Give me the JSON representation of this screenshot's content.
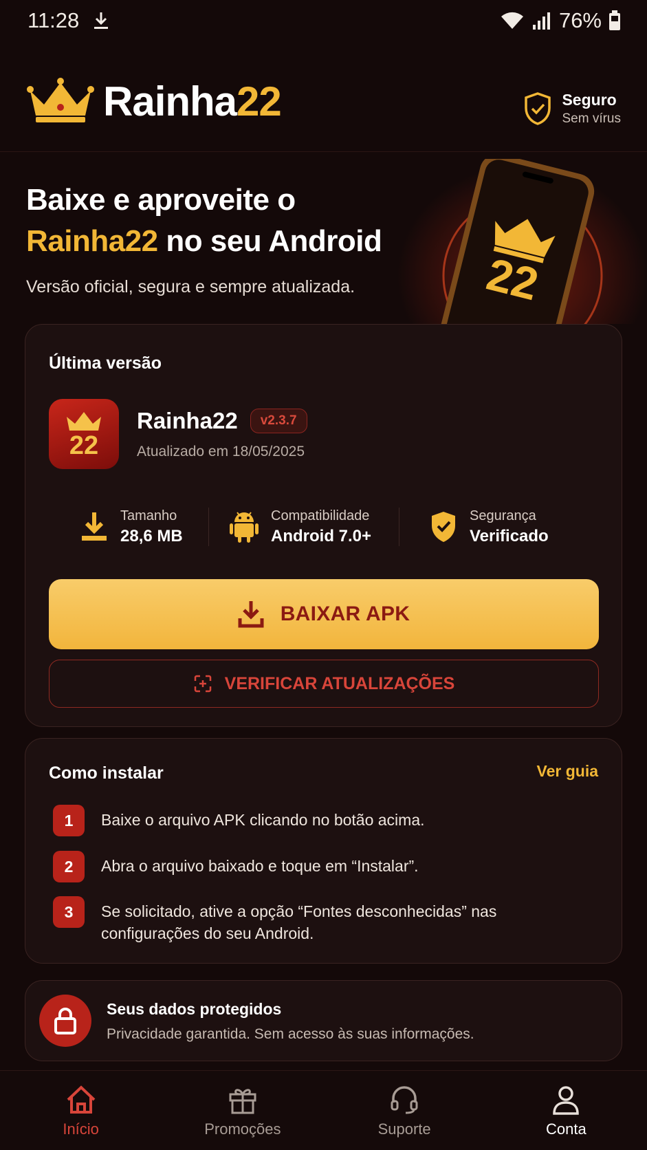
{
  "status_bar": {
    "time": "11:28",
    "battery": "76%"
  },
  "header": {
    "brand_main": "Rainha",
    "brand_accent": "22",
    "secure_title": "Seguro",
    "secure_subtitle": "Sem vírus"
  },
  "hero": {
    "title_line1": "Baixe e aproveite o",
    "title_accent": "Rainha22",
    "title_line2_rest": " no seu Android",
    "subtitle": "Versão oficial, segura e sempre atualizada.",
    "phone_number": "22"
  },
  "latest": {
    "section_title": "Última versão",
    "app_icon_number": "22",
    "app_name": "Rainha22",
    "version": "v2.3.7",
    "updated": "Atualizado em 18/05/2025",
    "specs": [
      {
        "label": "Tamanho",
        "value": "28,6 MB",
        "icon": "download-icon"
      },
      {
        "label": "Compatibilidade",
        "value": "Android 7.0+",
        "icon": "android-icon"
      },
      {
        "label": "Segurança",
        "value": "Verificado",
        "icon": "shield-check-icon"
      }
    ],
    "download_button": "BAIXAR APK",
    "check_updates_button": "VERIFICAR ATUALIZAÇÕES"
  },
  "install": {
    "title": "Como instalar",
    "guide_link": "Ver guia",
    "steps": [
      {
        "num": "1",
        "text": "Baixe o arquivo APK clicando no botão acima."
      },
      {
        "num": "2",
        "text": "Abra o arquivo baixado e toque em “Instalar”."
      },
      {
        "num": "3",
        "text": "Se solicitado, ative a opção “Fontes desconhecidas” nas configurações do seu Android."
      }
    ]
  },
  "privacy": {
    "title": "Seus dados protegidos",
    "subtitle": "Privacidade garantida. Sem acesso às suas informações."
  },
  "bottom_nav": [
    {
      "label": "Início",
      "icon": "home-icon",
      "active": true
    },
    {
      "label": "Promoções",
      "icon": "gift-icon",
      "active": false
    },
    {
      "label": "Suporte",
      "icon": "headset-icon",
      "active": false
    },
    {
      "label": "Conta",
      "icon": "user-icon",
      "active": false
    }
  ],
  "colors": {
    "gold": "#f2b736",
    "red": "#b8231a",
    "background": "#140909"
  }
}
